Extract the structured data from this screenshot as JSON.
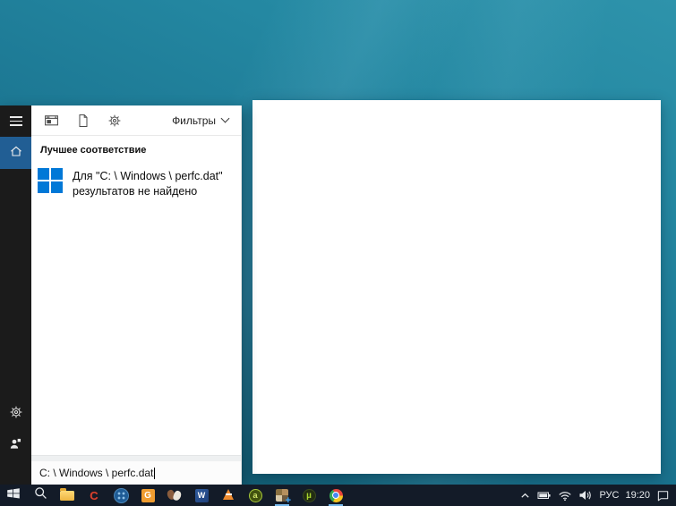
{
  "search_panel": {
    "header": {
      "filter_icons": [
        {
          "name": "apps-filter-icon"
        },
        {
          "name": "documents-filter-icon"
        },
        {
          "name": "settings-filter-icon"
        }
      ],
      "filters_label": "Фильтры",
      "filters_chevron_icon": "chevron-down-icon"
    },
    "sidebar": {
      "items": [
        {
          "name": "menu-icon"
        },
        {
          "name": "home-icon",
          "selected": true
        },
        {
          "name": "gear-icon"
        },
        {
          "name": "feedback-person-icon"
        }
      ],
      "selected_color": "#215e94"
    },
    "best_match_label": "Лучшее соответствие",
    "result": {
      "icon": "windows-logo-icon",
      "line1": "Для \"C: \\ Windows \\ perfc.dat\"",
      "line2": "результатов не найдено"
    },
    "search_input": {
      "value": "C: \\ Windows \\ perfc.dat"
    }
  },
  "taskbar": {
    "items": [
      {
        "name": "start-button"
      },
      {
        "name": "search-button"
      },
      {
        "name": "file-explorer"
      },
      {
        "name": "ccleaner",
        "letter": "C"
      },
      {
        "name": "blue-circle-app"
      },
      {
        "name": "orange-g-app",
        "letter": "G"
      },
      {
        "name": "colorful-app"
      },
      {
        "name": "word",
        "letter": "W"
      },
      {
        "name": "vlc"
      },
      {
        "name": "green-circle-app",
        "letter": "a"
      },
      {
        "name": "pixel-art-app",
        "running": true
      },
      {
        "name": "utorrent",
        "letter": "µ"
      },
      {
        "name": "chrome",
        "running": true
      }
    ],
    "tray": {
      "icons": [
        "chevron-up-icon",
        "battery-icon",
        "wifi-icon",
        "volume-icon",
        "action-center-icon"
      ],
      "language": "РУС",
      "time": "19:20"
    }
  },
  "colors": {
    "accent": "#0078d7",
    "wallpaper_teal": "#1b7591",
    "taskbar_bg": "#131b28",
    "sidebar_bg": "#1b1b1b",
    "sidebar_selected": "#215e94",
    "running_indicator": "#76b9ed"
  }
}
